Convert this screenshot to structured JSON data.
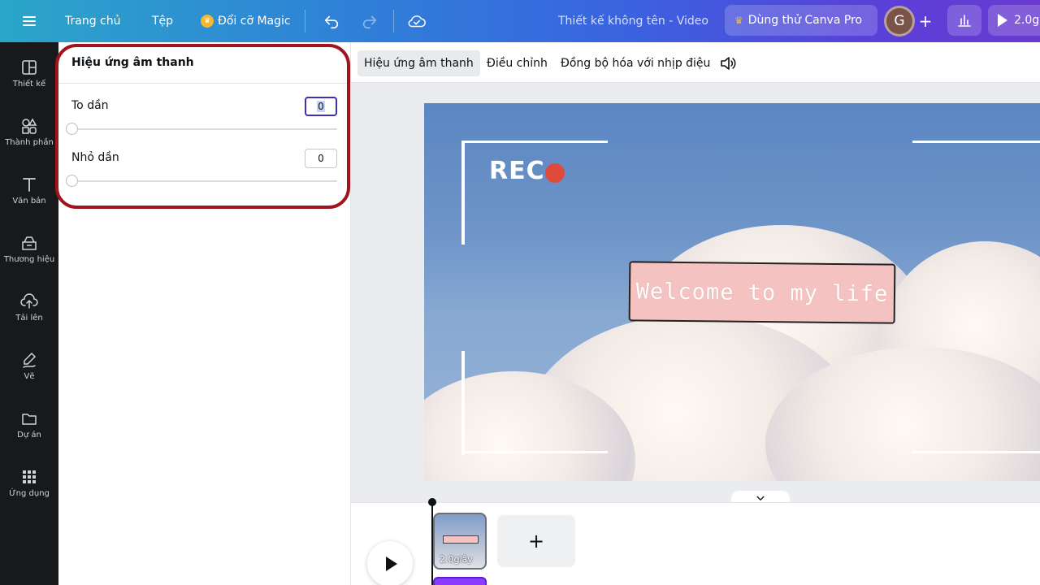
{
  "topbar": {
    "home": "Trang chủ",
    "file": "Tệp",
    "magic_resize": "Đổi cỡ Magic",
    "doc_title": "Thiết kế không tên - Video",
    "try_pro": "Dùng thử Canva Pro",
    "avatar_initial": "G",
    "play_duration": "2.0g"
  },
  "sidebar": {
    "items": [
      {
        "label": "Thiết kế",
        "icon": "layout-icon"
      },
      {
        "label": "Thành phần",
        "icon": "shapes-icon"
      },
      {
        "label": "Văn bản",
        "icon": "text-icon"
      },
      {
        "label": "Thương hiệu",
        "icon": "brand-icon"
      },
      {
        "label": "Tải lên",
        "icon": "upload-icon"
      },
      {
        "label": "Vẽ",
        "icon": "draw-icon"
      },
      {
        "label": "Dự án",
        "icon": "folder-icon"
      },
      {
        "label": "Ứng dụng",
        "icon": "apps-icon"
      }
    ]
  },
  "panel": {
    "title": "Hiệu ứng âm thanh",
    "fade_in": {
      "label": "To dần",
      "value": "0"
    },
    "fade_out": {
      "label": "Nhỏ dần",
      "value": "0"
    }
  },
  "context_toolbar": {
    "audio_effects": "Hiệu ứng âm thanh",
    "adjust": "Điều chỉnh",
    "beat_sync": "Đồng bộ hóa với nhịp điệu"
  },
  "canvas": {
    "rec_label": "REC",
    "banner_text": "Welcome to my life"
  },
  "timeline": {
    "clip_duration": "2.0giây",
    "add_label": "+"
  },
  "colors": {
    "highlight_ring": "#a0141e",
    "rec_dot": "#e04a3a",
    "banner_bg": "#f4c3c1",
    "audio_track": "#8b3dff"
  }
}
